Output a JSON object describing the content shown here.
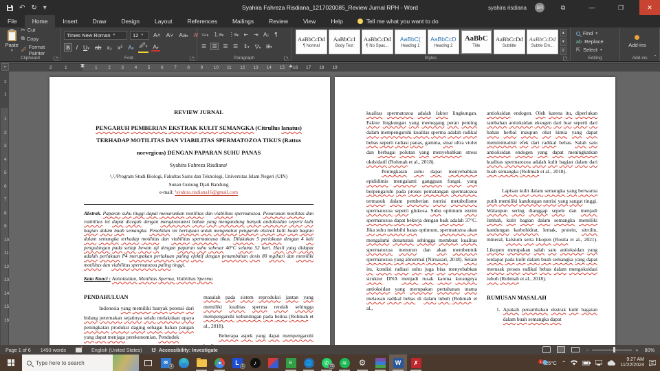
{
  "titlebar": {
    "title": "Syahira Fahreza Risdiana_1217020085_Review Jurnal RPH  -  Word",
    "user": "syahira risdiana",
    "avatar_initials": "SR"
  },
  "ribbon": {
    "tabs": [
      "File",
      "Home",
      "Insert",
      "Draw",
      "Design",
      "Layout",
      "References",
      "Mailings",
      "Review",
      "View",
      "Help"
    ],
    "active_tab": "Home",
    "tellme": "Tell me what you want to do",
    "clipboard": {
      "paste": "Paste",
      "cut": "Cut",
      "copy": "Copy",
      "format_painter": "Format Painter",
      "group": "Clipboard"
    },
    "font": {
      "name": "Times New Roman",
      "size": "12",
      "group": "Font"
    },
    "paragraph": {
      "group": "Paragraph"
    },
    "styles": {
      "group": "Styles",
      "items": [
        {
          "sample": "AaBbCcDd",
          "label": "¶ Normal"
        },
        {
          "sample": "AaBbCcI",
          "label": "Body Text"
        },
        {
          "sample": "AaBbCcDd",
          "label": "¶ No Spac..."
        },
        {
          "sample": "AaBbC(",
          "label": "Heading 1"
        },
        {
          "sample": "AaBbCcD",
          "label": "Heading 2"
        },
        {
          "sample": "AaBbC",
          "label": "Title"
        },
        {
          "sample": "AaBbCcDd",
          "label": "Subtitle"
        },
        {
          "sample": "AaBbCcDd",
          "label": "Subtle Em..."
        }
      ],
      "selected": "Title"
    },
    "editing": {
      "find": "Find",
      "replace": "Replace",
      "select": "Select",
      "group": "Editing"
    },
    "addins": {
      "button": "Add-ins",
      "group": "Add-ins"
    }
  },
  "ruler": {
    "pre": [
      "2",
      "1"
    ],
    "main": [
      "1",
      "2",
      "3",
      "4",
      "5",
      "6",
      "7",
      "8",
      "9",
      "10",
      "11",
      "12",
      "13",
      "14",
      "15",
      "16"
    ],
    "post": [
      "17",
      "18",
      "19"
    ],
    "v_pre": [
      "2",
      "1"
    ],
    "v_main": [
      "1",
      "2",
      "3",
      "4",
      "5",
      "6",
      "7",
      "8",
      "9",
      "10",
      "11",
      "12",
      "13",
      "14",
      "15",
      "16"
    ]
  },
  "document": {
    "page1": {
      "review_label": "REVIEW JURNAL",
      "title_l1": "PENGARUH PEMBERIAN EKSTRAK KULIT SEMANGKA (Citrullus lanatus)",
      "title_l2": "TERHADAP MOTILITAS DAN VIABILITAS SPERMATOZOA TIKUS (Rattus",
      "title_l3": "norvegicus) DENGAN PAPARAN SUHU PANAS",
      "author": "Syahira Fahreza Risdiana¹",
      "affil_l1": "¹,²,³Program Studi Biologi, Fakultas Sains dan Teknologi, Universitas Islam Negeri (UIN)",
      "affil_l2": "Sunan Gunung Djati Bandung",
      "email_label": "e-mail:",
      "email_link": "¹syahira.risdiana16@gmail.com",
      "abstract_label": "Abstrak.",
      "abstract_text": "Paparan suhu tinggi dapat menurunkan motilitas dan viabilitas spermatozoa. Penurunan motilitas dan viabilitas ini dapat dicegah dengan mengkonsumsi bahan yang mengandung banyak antioksidan seperti kulit bagian dalam buah semangka. Penelitian ini bertujuan untuk mengetahui pengaruh ekstrak kulit buah bagian dalam semangka terhadap motilitas dan viabilitas spermatozoa tikus. Dilakukan 5 perlakuan dengan 4 kali pengulangan pada setiap hewan uji dengan paparan suhu sebesar 40°C selama 52 hari. Hasil yang didapat adalah perlakuan P4 merupakan perlakuan paling efektif dengan penambahan dosis 80 mg/hari dan memiliki motilitas dan viabilitas spermatozoa paling tinggi.",
      "keywords_label": "Kata Kunci :",
      "keywords_text": "Antioksidan, Motilitas Sperma, Viabilitas Sperma",
      "section1": "PENDAHULUAN",
      "col1_para": "Indonesia yang memiliki banyak potensi dari bidang peternakan sejatinya selalu melakukan upaya peningkatan produksi daging sebagai bahan pangan yang dapat menjaga perekonomian. Penduduk",
      "col2_para1": "masalah pada sistem reproduksi jantan yang memiliki kualitas sperma rendah sehingga mempengaruhi kebuntingan pada betina (Rohmah et al., 2018).",
      "col2_para2": "Beberapa aspek yang dapat mempengaruhi kualitas spermatozoa"
    },
    "page2": {
      "col1_para1": "kualitas spermatozoa adalah faktor lingkungan. Faktor lingkungan yang memegang peran penting dalam mempengaruhi kualitas sperma adalah radikal bebas seperti radiasi panas, gamma, sinar ultra violet dan berbagai polutan yang menyebabkan stress okdsidatif (Rohmah et al., 2018).",
      "col1_para2": "Peningkatan suhu dapat menyebabkan epididimis mengalami gangguan fungsi, yang berpengaruhi pada proses pematangan spermatozoa termasuk dalam pemberian nutrisi metabolisme spermatozoa seperti glukosa. Suhu optimum enzim spermatozoa dapat bekerja dengan baik adalah 37°C. Jika suhu melebihi batas optimum, spermatozoa akan mengalami denaturasi sehingga membuat kualitas spermatozoa menurun dan akan membentuk spermatozoa yang abnormal (Nirnasari, 2018). Selain itu, kondisi radiasi suhu juga bisa menyebabkan struktur DNA menjadi rusak karena kurangnya antioksidan yang merupakan pertahanan utama melawan radikal bebas di dalam tubuh (Rohmah et al.,",
      "col2_para1": "antioksidan endogen. Oleh karena itu, diperlukan tambahan antioksidan eksogen dari luar seperti dari bahan herbal maupun obat kimia yang dapat meminimalisir efek dari radikal bebas. Salah satu antioksidan endogen yang dapat meningkatkan kualitas spermatozoa adalah kulit bagian dalam dari buah semangka (Rohmah et al., 2018).",
      "col2_para2": "Lapisan kulit dalam semangka yang berwarna putih memiliki kandungan nutrisi yang sangat tinggi. Walaupun sering dianggap sepele dan menjadi limbah, kulit bagian dalam semangka memiliki kandungan karbohidrat, lemak, protein, sitrulin, mineral, kalsium serta likopen (Rosita et al., 2021). Likopen merupakan salah satu antioksidan yang terdapat pada kulit dalam buah semangka yang dapat merusak proses radikal bebas dalam mengoksidasi tubuh (Rohmah et al., 2018).",
      "section2": "RUMUSAN MASALAH",
      "item1_num": "1.",
      "item1_text": "Apakah penambahan ekstrak kulit bagaian dalam buah semangka dapat"
    },
    "misspelled": [
      "paparan",
      "suhu",
      "tinggi",
      "dapat",
      "menurunkan",
      "motilitas",
      "viabilitas",
      "spermatozoa",
      "penurunan",
      "dicegah",
      "mengkonsumsi",
      "bahan",
      "yang",
      "mengandung",
      "banyak",
      "antioksidan",
      "seperti",
      "kulit",
      "buah",
      "semangka",
      "penelitian",
      "bertujuan",
      "untuk",
      "mengetahui",
      "pengaruh",
      "ekstrak",
      "bagian",
      "terhadap",
      "tikus",
      "dilakukan",
      "perlakuan",
      "kali",
      "pengulangan",
      "pada",
      "setiap",
      "hewan",
      "uji",
      "sebesar",
      "selama",
      "hari",
      "hasil",
      "didapat",
      "adalah",
      "merupakan",
      "paling",
      "efektif",
      "penambahan",
      "dosis",
      "memiliki",
      "kata",
      "kunci",
      "sperma",
      "potensi",
      "dari",
      "bidang",
      "peternakan",
      "sejatinya",
      "selalu",
      "melakukan",
      "upaya",
      "peningkatan",
      "produksi",
      "daging",
      "sebagai",
      "pangan",
      "menjaga",
      "perekonomian",
      "penduduk",
      "masalah",
      "sistem",
      "reproduksi",
      "jantan",
      "kualitas",
      "rendah",
      "sehingga",
      "mempengaruhi",
      "kebuntingan",
      "betina",
      "rohmah",
      "beberapa",
      "aspek",
      "faktor",
      "lingkungan",
      "memegang",
      "peran",
      "penting",
      "dalam",
      "radikal",
      "bebas",
      "radiasi",
      "panas",
      "sinar",
      "berbagai",
      "polutan",
      "menyebabkan",
      "okdsidatif",
      "epididimis",
      "mengalami",
      "gangguan",
      "fungsi",
      "berpengaruhi",
      "proses",
      "pematangan",
      "termasuk",
      "pemberian",
      "nutrisi",
      "metabolisme",
      "glukosa",
      "enzim",
      "bekerja",
      "baik",
      "jika",
      "melebihi",
      "batas",
      "akan",
      "denaturasi",
      "membuat",
      "menurun",
      "membentuk",
      "abnormal",
      "nirnasari",
      "selain",
      "itu",
      "kondisi",
      "juga",
      "bisa",
      "struktur",
      "menjadi",
      "rusak",
      "karena",
      "kurangnya",
      "pertahanan",
      "utama",
      "melawan",
      "tubuh",
      "endogen",
      "oleh",
      "diperlukan",
      "tambahan",
      "eksogen",
      "luar",
      "herbal",
      "maupun",
      "obat",
      "kimia",
      "meminimalisir",
      "efek",
      "salah",
      "satu",
      "meningkatkan",
      "lapisan",
      "berwarna",
      "putih",
      "kandungan",
      "sangat",
      "walaupun",
      "sering",
      "dianggap",
      "sepele",
      "limbah",
      "karbohidrat",
      "sitrulin",
      "kalsium",
      "serta",
      "likopen",
      "rosita",
      "terdapat",
      "merusak",
      "mengoksidasi",
      "apakah",
      "bagaian",
      "lanatus",
      "norvegicus",
      "mg/hari"
    ]
  },
  "statusbar": {
    "page": "Page 1 of 6",
    "words": "1493 words",
    "language": "English (United States)",
    "accessibility": "Accessibility: Investigate",
    "zoom": "80%"
  },
  "taskbar": {
    "search_placeholder": "Type here to search",
    "badges": {
      "mail": "1",
      "app_l": "1",
      "whatsapp": "73",
      "weather": "1"
    },
    "weather_temp": "25°C",
    "time": "9:27 AM",
    "date": "11/22/2024"
  }
}
